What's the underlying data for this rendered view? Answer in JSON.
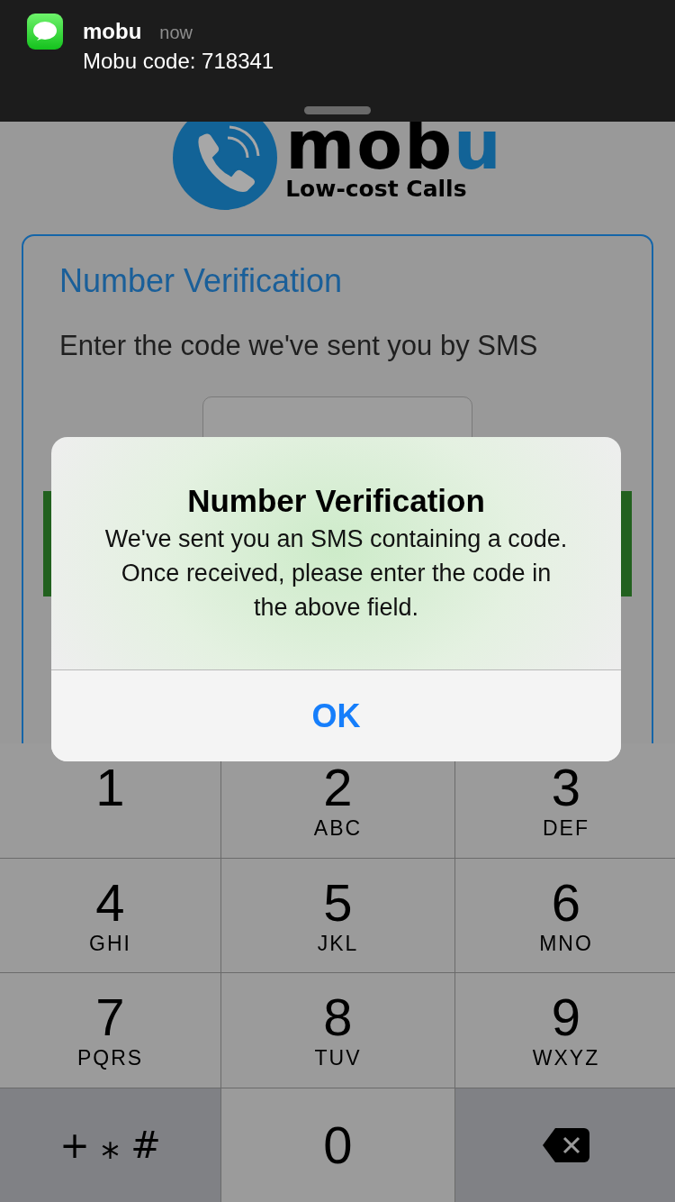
{
  "notification": {
    "app": "mobu",
    "time": "now",
    "message": "Mobu code: 718341"
  },
  "logo": {
    "wordmark": "mob",
    "wordmark_accent": "u",
    "tagline": "Low-cost Calls"
  },
  "card": {
    "title": "Number Verification",
    "instruction": "Enter the code we've sent you by SMS"
  },
  "alert": {
    "title": "Number Verification",
    "message": "We've sent you an SMS containing a code. Once received, please enter the code in the above field.",
    "button": "OK"
  },
  "keypad": [
    {
      "kind": "digit",
      "digit": "1"
    },
    {
      "kind": "digit",
      "digit": "2",
      "letters": "ABC"
    },
    {
      "kind": "digit",
      "digit": "3",
      "letters": "DEF"
    },
    {
      "kind": "digit",
      "digit": "4",
      "letters": "GHI"
    },
    {
      "kind": "digit",
      "digit": "5",
      "letters": "JKL"
    },
    {
      "kind": "digit",
      "digit": "6",
      "letters": "MNO"
    },
    {
      "kind": "digit",
      "digit": "7",
      "letters": "PQRS"
    },
    {
      "kind": "digit",
      "digit": "8",
      "letters": "TUV"
    },
    {
      "kind": "digit",
      "digit": "9",
      "letters": "WXYZ"
    },
    {
      "kind": "symbols",
      "label": "+ ⁎ #"
    },
    {
      "kind": "digit",
      "digit": "0"
    },
    {
      "kind": "delete"
    }
  ]
}
